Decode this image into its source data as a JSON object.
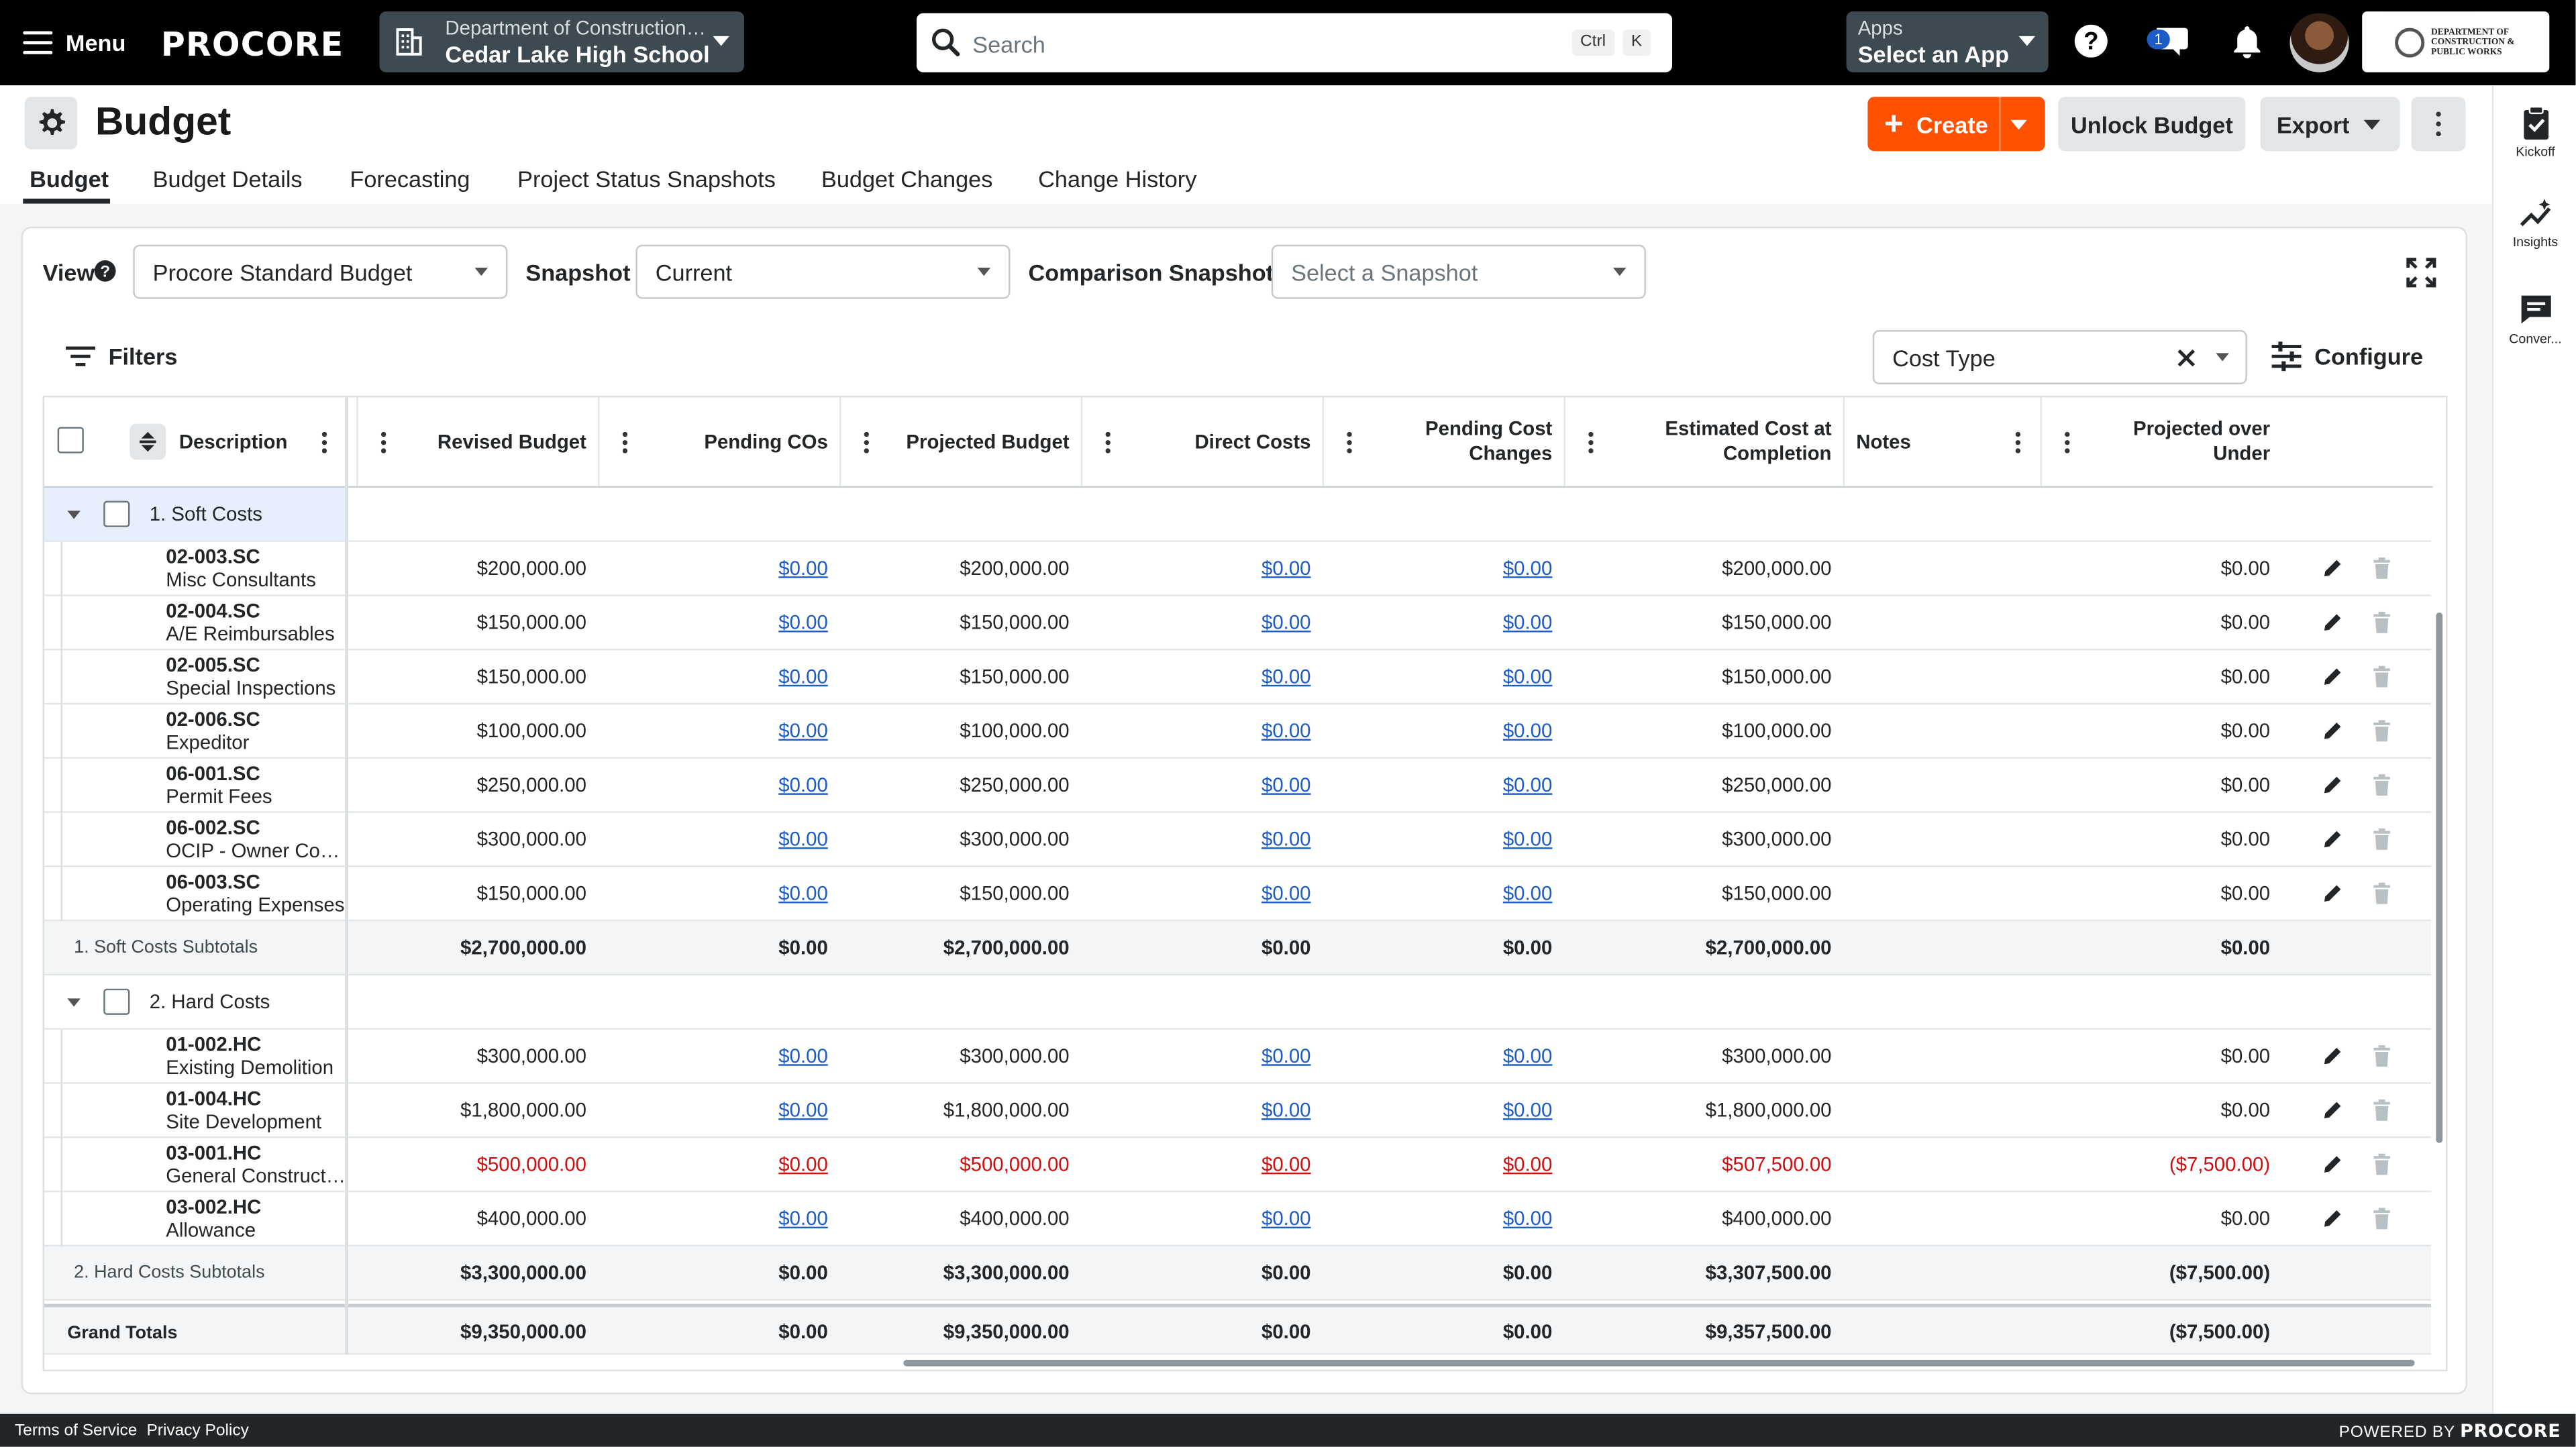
{
  "topbar": {
    "menu_label": "Menu",
    "logo": "PROCORE",
    "project_parent": "Department of Construction…",
    "project_name": "Cedar Lake High School",
    "search_placeholder": "Search",
    "shortcut_ctrl": "Ctrl",
    "shortcut_k": "K",
    "apps_label": "Apps",
    "apps_value": "Select an App",
    "notification_count": "1",
    "company_logo_text": "DEPARTMENT OF CONSTRUCTION & PUBLIC WORKS"
  },
  "page": {
    "title": "Budget",
    "buttons": {
      "create": "Create",
      "unlock": "Unlock Budget",
      "export": "Export"
    },
    "tabs": [
      "Budget",
      "Budget Details",
      "Forecasting",
      "Project Status Snapshots",
      "Budget Changes",
      "Change History"
    ]
  },
  "right_rail": [
    "Kickoff",
    "Insights",
    "Conver..."
  ],
  "toolbar": {
    "view_label": "View",
    "view_value": "Procore Standard Budget",
    "snapshot_label": "Snapshot",
    "snapshot_value": "Current",
    "comparison_label": "Comparison Snapshot",
    "comparison_placeholder": "Select a Snapshot",
    "filters_label": "Filters",
    "group_by_value": "Cost Type",
    "configure_label": "Configure"
  },
  "table": {
    "columns": [
      "Description",
      "Revised Budget",
      "Pending COs",
      "Projected Budget",
      "Direct Costs",
      "Pending Cost Changes",
      "Estimated Cost at Completion",
      "Notes",
      "Projected over Under"
    ],
    "groups": [
      {
        "label": "1. Soft Costs",
        "rows": [
          {
            "code": "02-003.SC",
            "name": "Misc Consultants",
            "revised": "$200,000.00",
            "pending_cos": "$0.00",
            "projected": "$200,000.00",
            "direct": "$0.00",
            "pending_cost": "$0.00",
            "ecac": "$200,000.00",
            "over_under": "$0.00",
            "red": false
          },
          {
            "code": "02-004.SC",
            "name": "A/E Reimbursables",
            "revised": "$150,000.00",
            "pending_cos": "$0.00",
            "projected": "$150,000.00",
            "direct": "$0.00",
            "pending_cost": "$0.00",
            "ecac": "$150,000.00",
            "over_under": "$0.00",
            "red": false
          },
          {
            "code": "02-005.SC",
            "name": "Special Inspections",
            "revised": "$150,000.00",
            "pending_cos": "$0.00",
            "projected": "$150,000.00",
            "direct": "$0.00",
            "pending_cost": "$0.00",
            "ecac": "$150,000.00",
            "over_under": "$0.00",
            "red": false
          },
          {
            "code": "02-006.SC",
            "name": "Expeditor",
            "revised": "$100,000.00",
            "pending_cos": "$0.00",
            "projected": "$100,000.00",
            "direct": "$0.00",
            "pending_cost": "$0.00",
            "ecac": "$100,000.00",
            "over_under": "$0.00",
            "red": false
          },
          {
            "code": "06-001.SC",
            "name": "Permit Fees",
            "revised": "$250,000.00",
            "pending_cos": "$0.00",
            "projected": "$250,000.00",
            "direct": "$0.00",
            "pending_cost": "$0.00",
            "ecac": "$250,000.00",
            "over_under": "$0.00",
            "red": false
          },
          {
            "code": "06-002.SC",
            "name": "OCIP - Owner Con…",
            "revised": "$300,000.00",
            "pending_cos": "$0.00",
            "projected": "$300,000.00",
            "direct": "$0.00",
            "pending_cost": "$0.00",
            "ecac": "$300,000.00",
            "over_under": "$0.00",
            "red": false
          },
          {
            "code": "06-003.SC",
            "name": "Operating Expenses",
            "revised": "$150,000.00",
            "pending_cos": "$0.00",
            "projected": "$150,000.00",
            "direct": "$0.00",
            "pending_cost": "$0.00",
            "ecac": "$150,000.00",
            "over_under": "$0.00",
            "red": false
          }
        ],
        "subtotal": {
          "label": "1. Soft Costs Subtotals",
          "revised": "$2,700,000.00",
          "pending_cos": "$0.00",
          "projected": "$2,700,000.00",
          "direct": "$0.00",
          "pending_cost": "$0.00",
          "ecac": "$2,700,000.00",
          "over_under": "$0.00"
        }
      },
      {
        "label": "2. Hard Costs",
        "rows": [
          {
            "code": "01-002.HC",
            "name": "Existing Demolition",
            "revised": "$300,000.00",
            "pending_cos": "$0.00",
            "projected": "$300,000.00",
            "direct": "$0.00",
            "pending_cost": "$0.00",
            "ecac": "$300,000.00",
            "over_under": "$0.00",
            "red": false
          },
          {
            "code": "01-004.HC",
            "name": "Site Development",
            "revised": "$1,800,000.00",
            "pending_cos": "$0.00",
            "projected": "$1,800,000.00",
            "direct": "$0.00",
            "pending_cost": "$0.00",
            "ecac": "$1,800,000.00",
            "over_under": "$0.00",
            "red": false
          },
          {
            "code": "03-001.HC",
            "name": "General Construct…",
            "revised": "$500,000.00",
            "pending_cos": "$0.00",
            "projected": "$500,000.00",
            "direct": "$0.00",
            "pending_cost": "$0.00",
            "ecac": "$507,500.00",
            "over_under": "($7,500.00)",
            "red": true
          },
          {
            "code": "03-002.HC",
            "name": "Allowance",
            "revised": "$400,000.00",
            "pending_cos": "$0.00",
            "projected": "$400,000.00",
            "direct": "$0.00",
            "pending_cost": "$0.00",
            "ecac": "$400,000.00",
            "over_under": "$0.00",
            "red": false
          }
        ],
        "subtotal": {
          "label": "2. Hard Costs Subtotals",
          "revised": "$3,300,000.00",
          "pending_cos": "$0.00",
          "projected": "$3,300,000.00",
          "direct": "$0.00",
          "pending_cost": "$0.00",
          "ecac": "$3,307,500.00",
          "over_under": "($7,500.00)"
        }
      }
    ],
    "grand_totals": {
      "label": "Grand Totals",
      "revised": "$9,350,000.00",
      "pending_cos": "$0.00",
      "projected": "$9,350,000.00",
      "direct": "$0.00",
      "pending_cost": "$0.00",
      "ecac": "$9,357,500.00",
      "over_under": "($7,500.00)"
    }
  },
  "footer": {
    "terms": "Terms of Service",
    "privacy": "Privacy Policy",
    "powered_by": "POWERED BY",
    "powered_brand": "PROCORE"
  },
  "colors": {
    "topbar_bg": "#000000",
    "accent_orange": "#ff5200",
    "link_blue": "#1d5cc7",
    "negative_red": "#d30e0e",
    "picker_bg": "#3d4a52"
  }
}
